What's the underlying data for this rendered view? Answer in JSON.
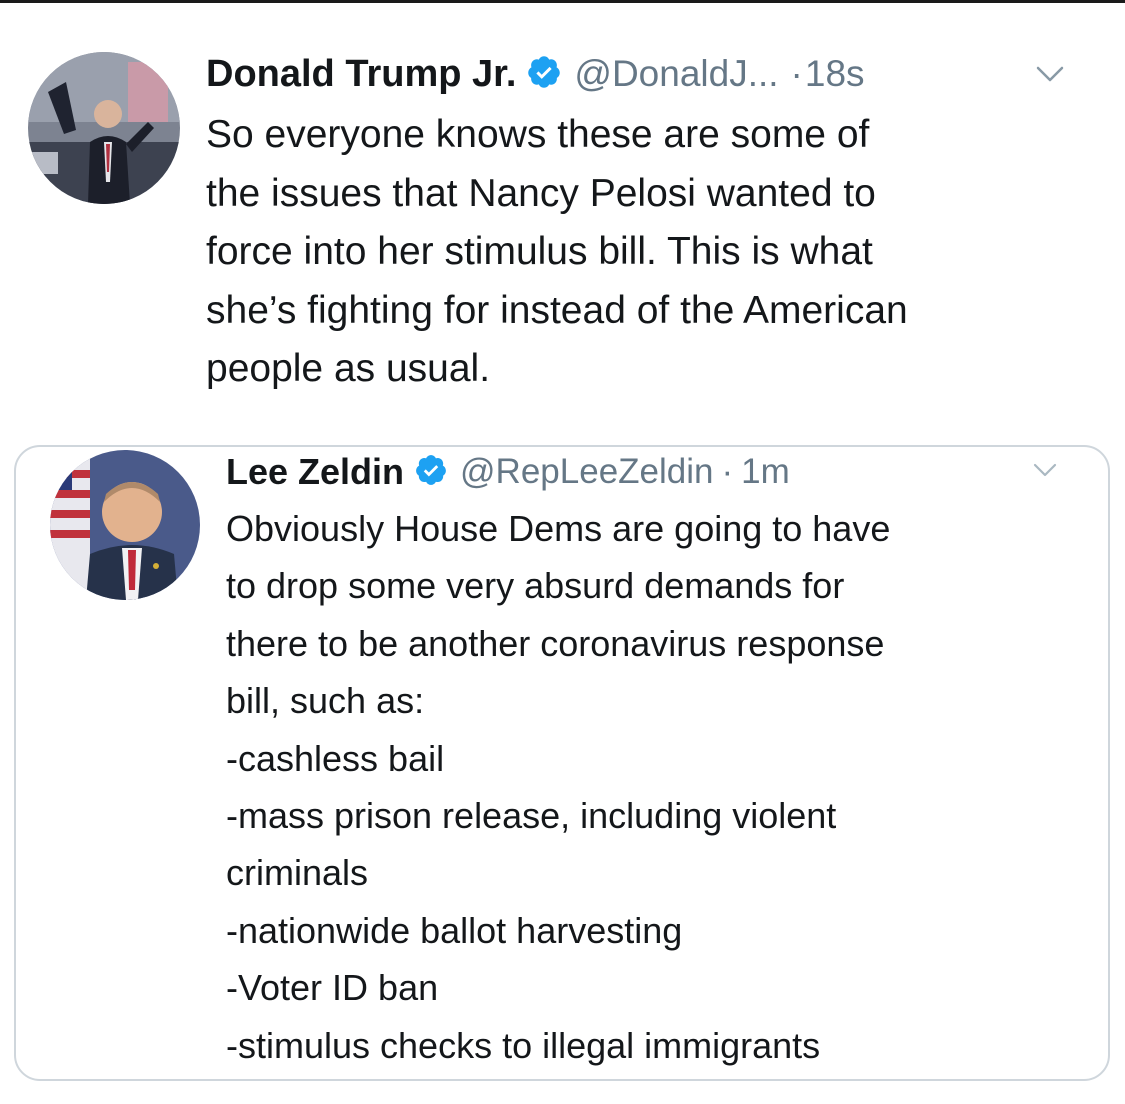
{
  "main_tweet": {
    "author_name": "Donald Trump Jr.",
    "handle": "@DonaldJ...",
    "separator": "·",
    "time": "18s",
    "text_lines": [
      "So everyone knows these are some of",
      "the issues that Nancy Pelosi wanted to",
      "force into her stimulus bill. This is what",
      "she’s fighting for instead of the American",
      "people as usual."
    ]
  },
  "quoted_tweet": {
    "author_name": "Lee Zeldin",
    "handle": "@RepLeeZeldin",
    "separator": "·",
    "time": "1m",
    "text_lines": [
      "Obviously House Dems are going to have",
      "to drop some very absurd demands for",
      "there to be another coronavirus response",
      "bill, such as:",
      "-cashless bail",
      "-mass prison release, including violent",
      "criminals",
      "-nationwide ballot harvesting",
      "-Voter ID ban",
      "-stimulus checks to illegal immigrants"
    ]
  },
  "icons": {
    "verified": "verified-badge-icon",
    "chevron": "chevron-down-icon"
  },
  "colors": {
    "text": "#14171a",
    "secondary_text": "#657786",
    "verified_blue": "#1da1f2",
    "card_border": "#cfd6dc"
  }
}
